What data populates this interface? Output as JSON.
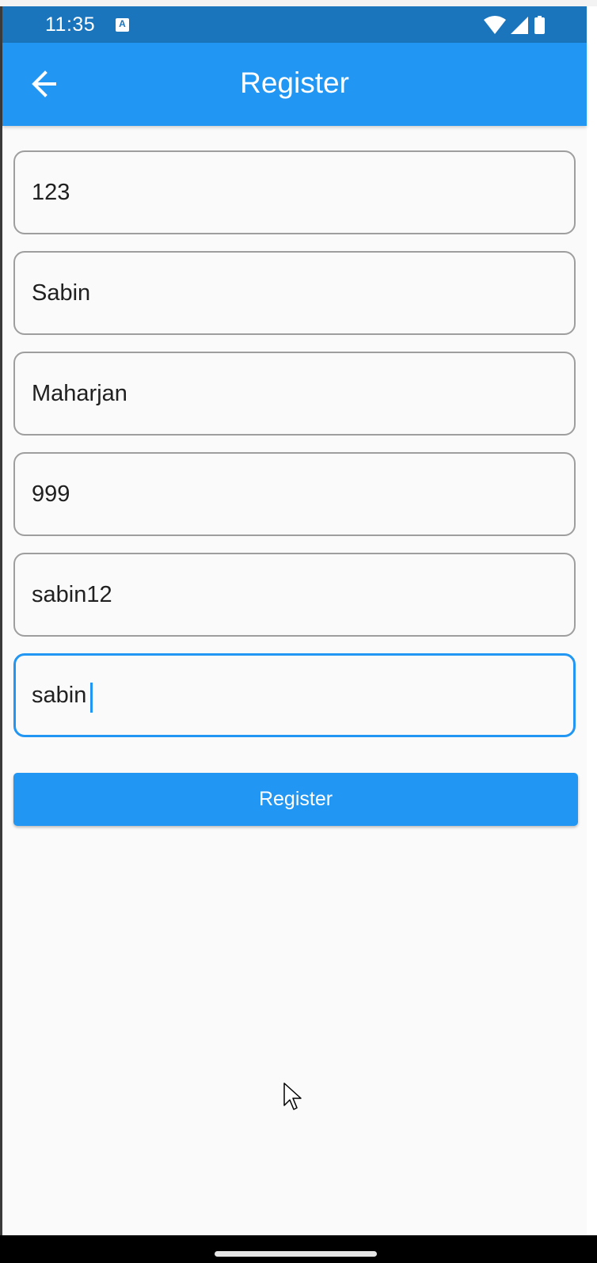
{
  "status_bar": {
    "time": "11:35",
    "notification_icon": "keyboard-a-icon",
    "notification_glyph": "A",
    "icons": [
      "wifi-icon",
      "cell-signal-icon",
      "battery-icon"
    ]
  },
  "app_bar": {
    "title": "Register",
    "back_icon": "arrow-back-icon"
  },
  "form": {
    "fields": [
      {
        "value": "123"
      },
      {
        "value": "Sabin"
      },
      {
        "value": "Maharjan"
      },
      {
        "value": "999"
      },
      {
        "value": "sabin12"
      },
      {
        "value": "sabin",
        "focused": true
      }
    ],
    "submit_label": "Register"
  },
  "colors": {
    "status_bar": "#1b75bc",
    "app_bar": "#2196f3",
    "accent": "#2196f3",
    "background": "#fafafa",
    "field_border": "#9e9e9e"
  }
}
